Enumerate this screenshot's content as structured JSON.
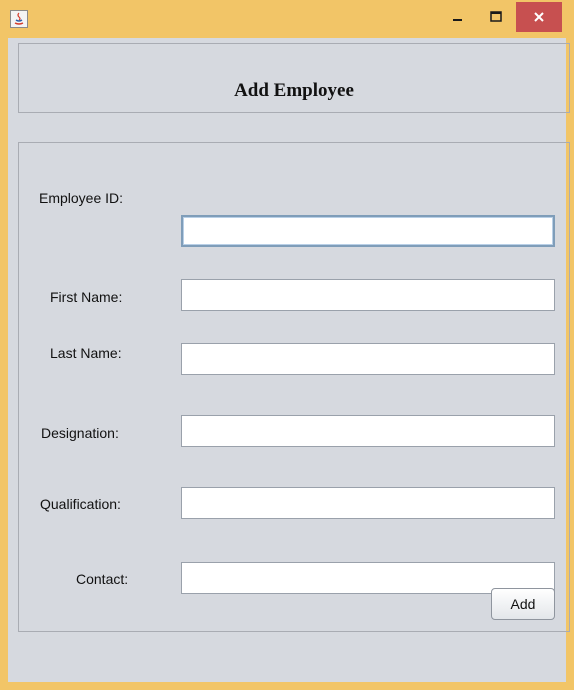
{
  "window": {
    "title": "",
    "controls": {
      "minimize": "minimize",
      "maximize": "maximize",
      "close": "close"
    }
  },
  "header": {
    "title": "Add Employee"
  },
  "form": {
    "fields": [
      {
        "label": "Employee ID:",
        "value": ""
      },
      {
        "label": "First Name:",
        "value": ""
      },
      {
        "label": "Last Name:",
        "value": ""
      },
      {
        "label": "Designation:",
        "value": ""
      },
      {
        "label": "Qualification:",
        "value": ""
      },
      {
        "label": "Contact:",
        "value": ""
      }
    ],
    "add_label": "Add"
  },
  "colors": {
    "title_bar": "#f2c567",
    "content_bg": "#d6d9df",
    "close_button": "#c75050"
  },
  "icons": [
    "java-app-icon",
    "minimize-icon",
    "maximize-icon",
    "close-icon"
  ]
}
